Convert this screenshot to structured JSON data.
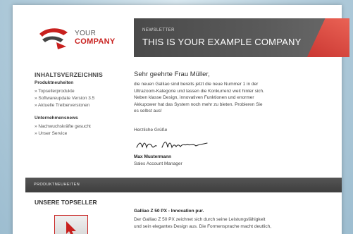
{
  "logo": {
    "line1": "YOUR",
    "line2": "COMPANY"
  },
  "banner": {
    "kicker": "NEWSLETTER",
    "headline": "THIS IS YOUR EXAMPLE COMPANY"
  },
  "toc": {
    "title": "INHALTSVERZEICHNIS",
    "section1": {
      "title": "Produktneuheiten",
      "links": [
        "» Topsellerprodukte",
        "» Softwareupdate Version 3.5",
        "» Aktuelle Treiberversionen"
      ]
    },
    "section2": {
      "title": "Unternehmensnews",
      "links": [
        "» Nachwuchskräfte gesucht",
        "» Unser Service"
      ]
    }
  },
  "letter": {
    "greeting": "Sehr geehrte Frau Müller,",
    "body_lines": [
      "die neuen Galliao sind bereits jetzt die neue Nummer 1 in der",
      "Ultrazoom-Kategorie und lassen die Konkurrenz weit hinter sich.",
      "Neben klasse Design, innovativen Funktionen und enormer",
      "Akkupower hat das System noch mehr zu bieten. Probieren Sie",
      "es selbst aus!"
    ],
    "regards": "Herzliche Grüße",
    "name": "Max Mustermann",
    "role": "Sales Account Manager"
  },
  "section_bar": {
    "label": "PRODUKTNEUHEITEN"
  },
  "topseller": {
    "title": "UNSERE TOPSELLER",
    "product_name": "Galliao Z 50 PX - Innovation pur.",
    "desc_lines": [
      "Der Galliao Z 50 PX zeichnet sich durch seine Leistungsfähigkeit",
      "und sein elegantes Design aus. Die Formensprache macht deutlich,"
    ]
  },
  "colors": {
    "accent": "#c8201e",
    "dark_bar": "#444444"
  },
  "icons": {
    "logo_mark": "company-logo-mark",
    "product_arrow": "cursor-arrow-icon"
  }
}
